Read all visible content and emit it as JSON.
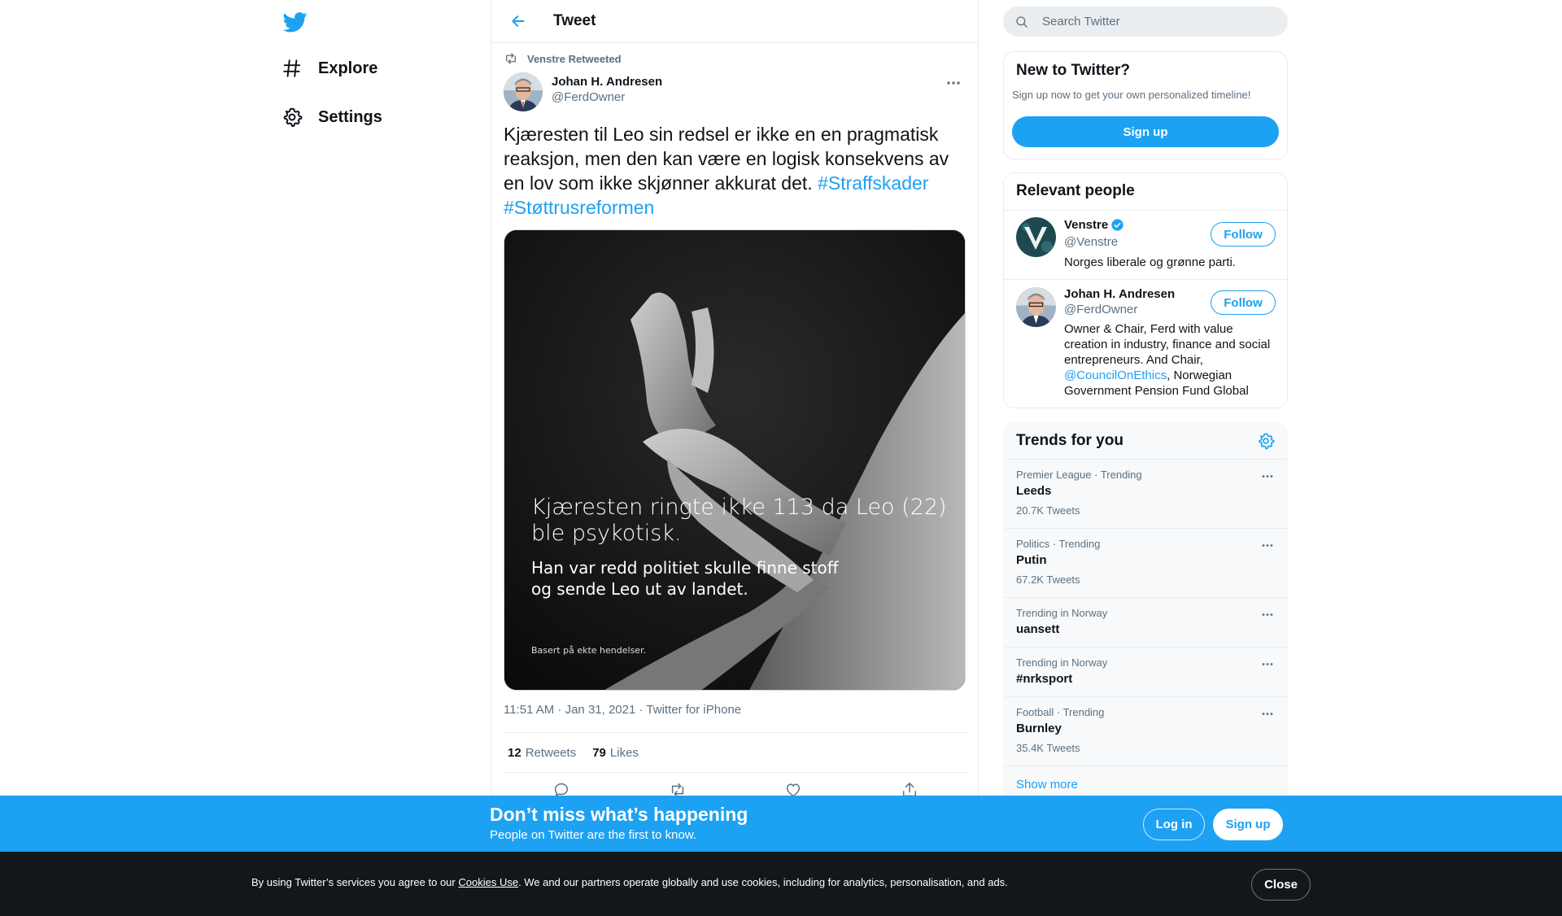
{
  "nav": {
    "logo_icon": "twitter-bird-icon",
    "items": [
      {
        "label": "Explore",
        "icon": "hashtag-icon"
      },
      {
        "label": "Settings",
        "icon": "gear-icon"
      }
    ]
  },
  "header": {
    "title": "Tweet",
    "back_icon": "arrow-left-icon"
  },
  "tweet": {
    "retweeted_by": "Venstre Retweeted",
    "author_name": "Johan H. Andresen",
    "author_handle": "@FerdOwner",
    "text": "Kjæresten til Leo sin redsel er ikke en en pragmatisk reaksjon, men den kan være en logisk konsekvens av en lov som ikke skjønner akkurat det.",
    "hashtags": [
      "#Straffskader",
      "#Støttrusreformen"
    ],
    "media": {
      "caption_line1": "Kjæresten ringte ikke 113 da Leo (22)",
      "caption_line2": "ble psykotisk.",
      "caption_line3": "Han var redd politiet skulle finne stoff",
      "caption_line4": "og sende Leo ut av landet.",
      "caption_footer": "Basert på ekte hendelser."
    },
    "timestamp": "11:51 AM · Jan 31, 2021",
    "source_separator": "·",
    "source": "Twitter for iPhone",
    "retweets_count": "12",
    "retweets_label": "Retweets",
    "likes_count": "79",
    "likes_label": "Likes"
  },
  "search": {
    "placeholder": "Search Twitter"
  },
  "new_to_twitter": {
    "title": "New to Twitter?",
    "subtitle": "Sign up now to get your own personalized timeline!",
    "button": "Sign up"
  },
  "relevant_people": {
    "title": "Relevant people",
    "people": [
      {
        "name": "Venstre",
        "verified": true,
        "handle": "@Venstre",
        "bio": "Norges liberale og grønne parti.",
        "follow_label": "Follow"
      },
      {
        "name": "Johan H. Andresen",
        "verified": false,
        "handle": "@FerdOwner",
        "bio_part1": "Owner & Chair, Ferd with value creation in industry, finance and social entrepreneurs. And Chair,",
        "bio_mention": "@CouncilOnEthics",
        "bio_part2": ", Norwegian Government Pension Fund Global",
        "follow_label": "Follow"
      }
    ]
  },
  "trends": {
    "title": "Trends for you",
    "items": [
      {
        "context": "Premier League · Trending",
        "name": "Leeds",
        "count": "20.7K Tweets"
      },
      {
        "context": "Politics · Trending",
        "name": "Putin",
        "count": "67.2K Tweets"
      },
      {
        "context": "Trending in Norway",
        "name": "uansett",
        "count": ""
      },
      {
        "context": "Trending in Norway",
        "name": "#nrksport",
        "count": ""
      },
      {
        "context": "Football · Trending",
        "name": "Burnley",
        "count": "35.4K Tweets"
      }
    ],
    "show_more": "Show more"
  },
  "banner": {
    "headline": "Don’t miss what’s happening",
    "subline": "People on Twitter are the first to know.",
    "login": "Log in",
    "signup": "Sign up"
  },
  "cookie": {
    "prefix": "By using Twitter’s services you agree to our ",
    "link": "Cookies Use",
    "suffix": ". We and our partners operate globally and use cookies, including for analytics, personalisation, and ads.",
    "close": "Close"
  },
  "colors": {
    "accent": "#1da1f2",
    "text": "#0f1419",
    "secondary": "#5b7083",
    "cookie_bg": "#14171a"
  }
}
